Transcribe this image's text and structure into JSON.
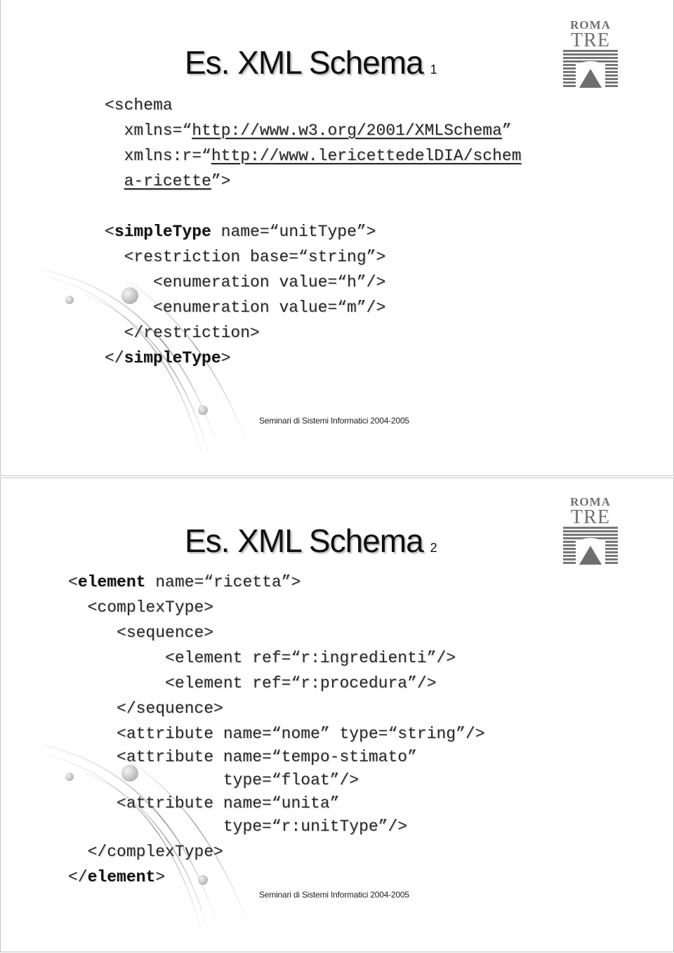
{
  "slides": [
    {
      "title": "Es. XML Schema",
      "number": "1",
      "logo": {
        "line1": "ROMA",
        "line2": "TRE"
      },
      "code_lines": [
        {
          "indent": "",
          "parts": [
            {
              "t": "<schema"
            }
          ]
        },
        {
          "indent": "  ",
          "parts": [
            {
              "t": "xmlns=“"
            },
            {
              "t": "http://www.w3.org/2001/XMLSchema",
              "u": true
            },
            {
              "t": "”"
            }
          ]
        },
        {
          "indent": "  ",
          "parts": [
            {
              "t": "xmlns:r=“"
            },
            {
              "t": "http://www.lericettedelDIA/schem",
              "u": true
            }
          ]
        },
        {
          "indent": "  ",
          "parts": [
            {
              "t": "a-ricette",
              "u": true
            },
            {
              "t": "”>"
            }
          ]
        },
        {
          "indent": "",
          "parts": [
            {
              "t": ""
            }
          ]
        },
        {
          "indent": "",
          "parts": [
            {
              "t": "<"
            },
            {
              "t": "simpleType",
              "b": true
            },
            {
              "t": " name=“unitType”>"
            }
          ]
        },
        {
          "indent": "  ",
          "parts": [
            {
              "t": "<restriction base=“string”>"
            }
          ]
        },
        {
          "indent": "     ",
          "parts": [
            {
              "t": "<enumeration value=“h”/>"
            }
          ]
        },
        {
          "indent": "     ",
          "parts": [
            {
              "t": "<enumeration value=“m”/>"
            }
          ]
        },
        {
          "indent": "  ",
          "parts": [
            {
              "t": "</restriction>"
            }
          ]
        },
        {
          "indent": "",
          "parts": [
            {
              "t": "</"
            },
            {
              "t": "simpleType",
              "b": true
            },
            {
              "t": ">"
            }
          ]
        }
      ],
      "footer": "Seminari di Sistemi Informatici 2004-2005"
    },
    {
      "title": "Es. XML Schema",
      "number": "2",
      "logo": {
        "line1": "ROMA",
        "line2": "TRE"
      },
      "code_lines": [
        {
          "indent": "",
          "parts": [
            {
              "t": "<"
            },
            {
              "t": "element",
              "b": true
            },
            {
              "t": " name=“ricetta”>"
            }
          ]
        },
        {
          "indent": "  ",
          "parts": [
            {
              "t": "<complexType>"
            }
          ]
        },
        {
          "indent": "     ",
          "parts": [
            {
              "t": "<sequence>"
            }
          ]
        },
        {
          "indent": "          ",
          "parts": [
            {
              "t": "<element ref=“r:ingredienti”/>"
            }
          ]
        },
        {
          "indent": "          ",
          "parts": [
            {
              "t": "<element ref=“r:procedura”/>"
            }
          ]
        },
        {
          "indent": "     ",
          "parts": [
            {
              "t": "</sequence>"
            }
          ]
        },
        {
          "indent": "     ",
          "parts": [
            {
              "t": "<attribute name=“nome” type=“string”/>"
            }
          ]
        },
        {
          "indent": "     ",
          "parts": [
            {
              "t": "<attribute name=“tempo-stimato”"
            }
          ],
          "tight": true
        },
        {
          "indent": "                ",
          "parts": [
            {
              "t": "type=“float”/>"
            }
          ]
        },
        {
          "indent": "     ",
          "parts": [
            {
              "t": "<attribute name=“unita”"
            }
          ],
          "tight": true
        },
        {
          "indent": "                ",
          "parts": [
            {
              "t": "type=“r:unitType”/>"
            }
          ]
        },
        {
          "indent": "  ",
          "parts": [
            {
              "t": "</complexType>"
            }
          ]
        },
        {
          "indent": "",
          "parts": [
            {
              "t": "</"
            },
            {
              "t": "element",
              "b": true
            },
            {
              "t": ">"
            }
          ]
        }
      ],
      "footer": "Seminari di Sistemi Informatici 2004-2005"
    }
  ],
  "colors": {
    "text": "#2a2a2a",
    "logo": "#707070",
    "border": "#c4c4c4"
  }
}
